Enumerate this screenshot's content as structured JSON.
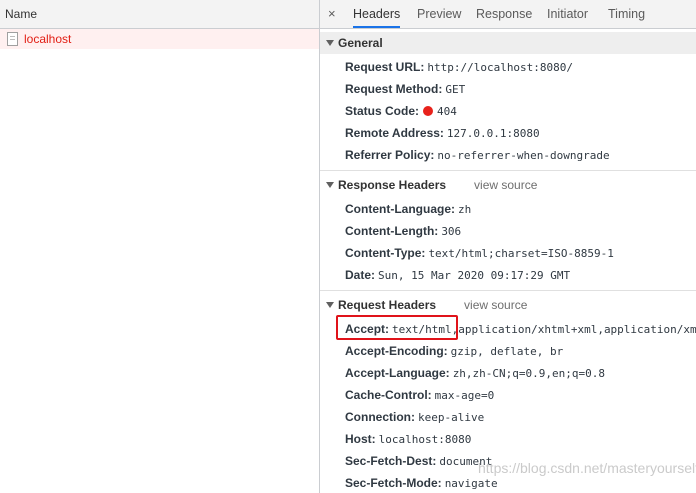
{
  "left": {
    "column_header": "Name",
    "requests": [
      {
        "name": "localhost"
      }
    ]
  },
  "tabs": {
    "close_glyph": "×",
    "items": [
      "Headers",
      "Preview",
      "Response",
      "Initiator",
      "Timing"
    ]
  },
  "general": {
    "title": "General",
    "rows": [
      {
        "key": "Request URL:",
        "value": "http://localhost:8080/"
      },
      {
        "key": "Request Method:",
        "value": "GET"
      },
      {
        "key": "Status Code:",
        "value": "404"
      },
      {
        "key": "Remote Address:",
        "value": "127.0.0.1:8080"
      },
      {
        "key": "Referrer Policy:",
        "value": "no-referrer-when-downgrade"
      }
    ]
  },
  "response_headers": {
    "title": "Response Headers",
    "view_source": "view source",
    "rows": [
      {
        "key": "Content-Language:",
        "value": "zh"
      },
      {
        "key": "Content-Length:",
        "value": "306"
      },
      {
        "key": "Content-Type:",
        "value": "text/html;charset=ISO-8859-1"
      },
      {
        "key": "Date:",
        "value": "Sun, 15 Mar 2020 09:17:29 GMT"
      }
    ]
  },
  "request_headers": {
    "title": "Request Headers",
    "view_source": "view source",
    "rows": [
      {
        "key": "Accept:",
        "value": "text/html,application/xhtml+xml,application/xm"
      },
      {
        "key": "Accept-Encoding:",
        "value": "gzip, deflate, br"
      },
      {
        "key": "Accept-Language:",
        "value": "zh,zh-CN;q=0.9,en;q=0.8"
      },
      {
        "key": "Cache-Control:",
        "value": "max-age=0"
      },
      {
        "key": "Connection:",
        "value": "keep-alive"
      },
      {
        "key": "Host:",
        "value": "localhost:8080"
      },
      {
        "key": "Sec-Fetch-Dest:",
        "value": "document"
      },
      {
        "key": "Sec-Fetch-Mode:",
        "value": "navigate"
      }
    ]
  },
  "status_color": "#e8221b",
  "highlight_color": "#e0131a",
  "watermark": "https://blog.csdn.net/masteryourself"
}
